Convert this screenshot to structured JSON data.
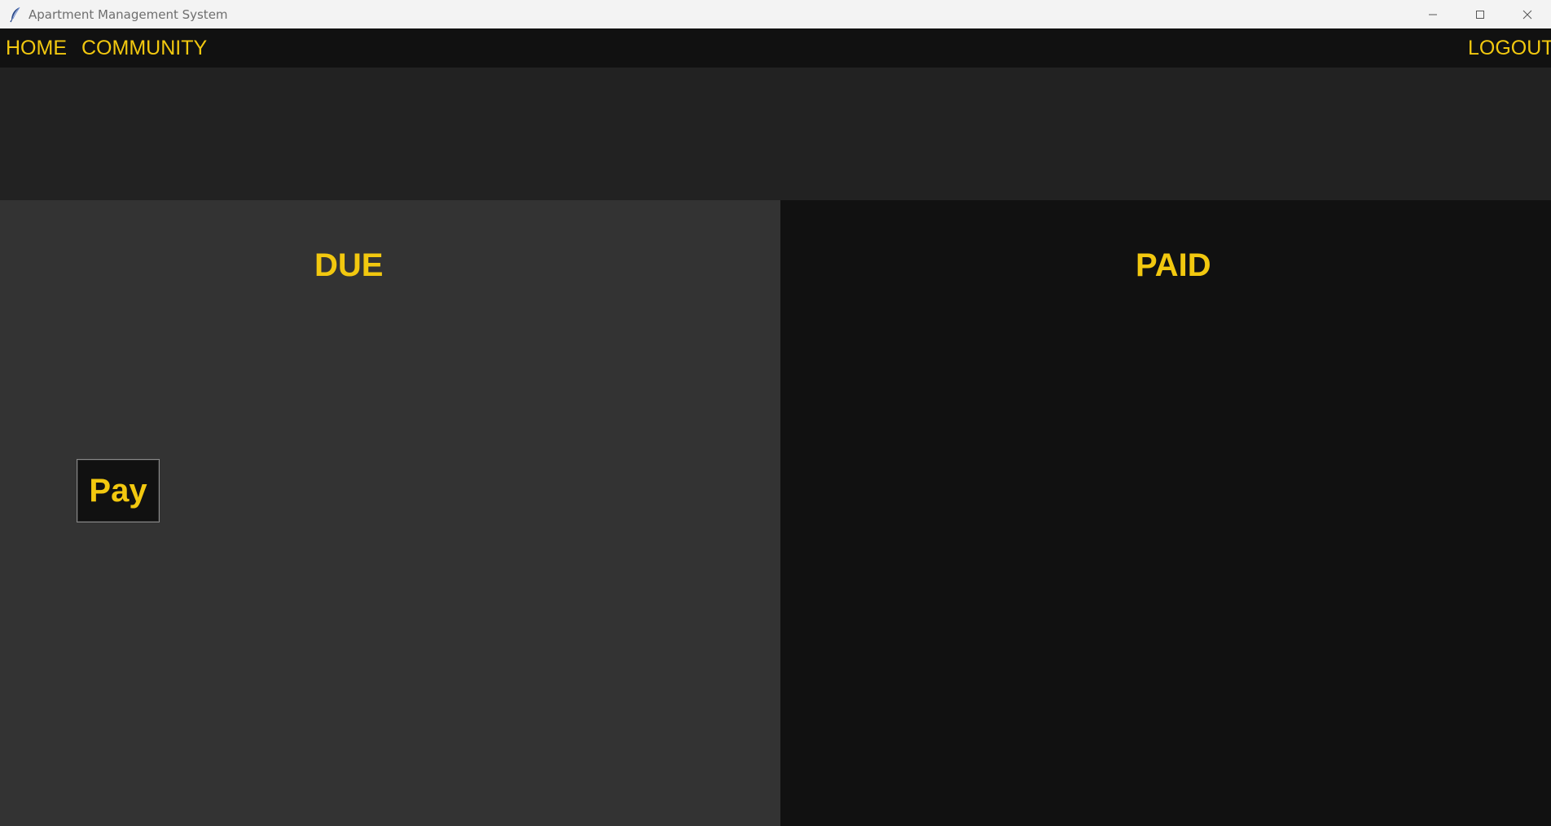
{
  "window": {
    "title": "Apartment Management System",
    "app_icon": "feather-icon",
    "controls": [
      "minimize-icon",
      "maximize-icon",
      "close-icon"
    ]
  },
  "nav": {
    "home_label": "HOME",
    "community_label": "COMMUNITY",
    "logout_label": "LOGOUT"
  },
  "panels": {
    "due": {
      "heading": "DUE",
      "pay_button_label": "Pay"
    },
    "paid": {
      "heading": "PAID"
    }
  },
  "colors": {
    "accent": "#f2c80f",
    "navbar_bg": "#111111",
    "banner_bg": "#222222",
    "due_bg": "#333333",
    "paid_bg": "#111111",
    "titlebar_bg": "#f3f3f3"
  }
}
